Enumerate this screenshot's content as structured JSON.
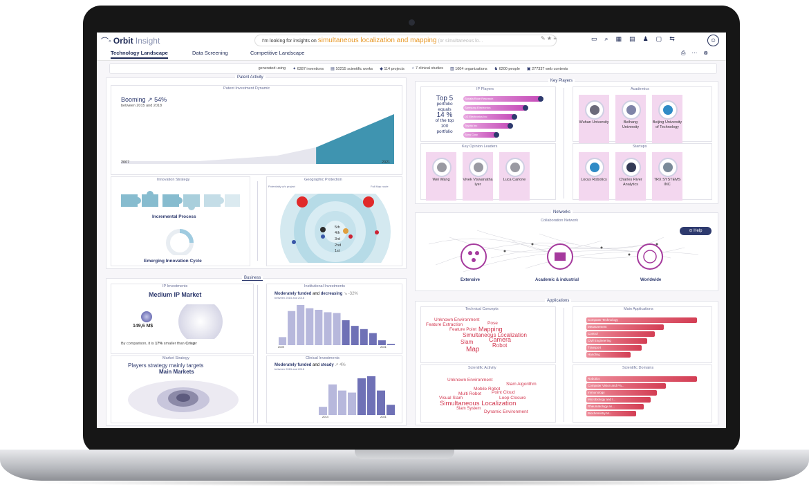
{
  "topbar": {
    "logo_bold": "Orbit",
    "logo_light": "Insight",
    "search_prefix": "I'm looking for insights on",
    "search_keyword": "simultaneous localization and mapping",
    "search_ghost": "(or simultaneous lo...",
    "icons": [
      "edit-icon",
      "star-icon",
      "filter-icon",
      "folder-icon",
      "search-icon",
      "grid-icon",
      "calendar-icon",
      "user-icon",
      "chat-icon",
      "share-icon",
      "avatar-icon"
    ]
  },
  "tabs": {
    "items": [
      "Technology Landscape",
      "Data Screening",
      "Competitive Landscape"
    ],
    "active": "Technology Landscape"
  },
  "stats": {
    "prefix": "generated using",
    "items": [
      "6287 inventions",
      "10215 scientific works",
      "114 projects",
      "7 clinical studies",
      "1604 organizations",
      "6200 people",
      "277337 web contents"
    ]
  },
  "patent_activity": {
    "section": "Patent Activity",
    "sub": "Patent Investment Dynamic",
    "headline": "Booming ↗ 54%",
    "period": "between 2015 and 2018",
    "x_start": "2007",
    "x_end": "2021",
    "chart_data": {
      "type": "area",
      "x": [
        2007,
        2009,
        2011,
        2013,
        2015,
        2017,
        2019,
        2021
      ],
      "values": [
        1,
        1,
        1,
        2,
        3,
        6,
        12,
        18
      ]
    }
  },
  "innovation": {
    "title": "Innovation Strategy",
    "label1": "Incremental Process",
    "label2": "Emerging Innovation Cycle"
  },
  "geo": {
    "title": "Geographic Protection",
    "left_label": "Potentially w/o project",
    "right_label": "Full Map route",
    "ranks": [
      "5th",
      "4th",
      "3rd",
      "2nd",
      "1st"
    ]
  },
  "business": {
    "section": "Business",
    "ip": {
      "title": "IP Investments",
      "heading": "Medium IP Market",
      "value": "149,6 M$",
      "compare_pre": "By comparison, it is",
      "compare_pct": "17%",
      "compare_mid": "smaller than",
      "compare_ref": "Crispr"
    },
    "institutional": {
      "title": "Institutional Investments",
      "headline_a": "Moderately funded",
      "headline_b": "and",
      "headline_c": "decreasing",
      "headline_d": "↘ -32%",
      "period": "between 2015 and 2018",
      "x_start": "2009",
      "x_end": "2021",
      "chart_data": {
        "type": "bar",
        "categories": [
          "2009",
          "2010",
          "2011",
          "2012",
          "2013",
          "2014",
          "2015",
          "2016",
          "2017",
          "2018",
          "2019",
          "2020",
          "2021"
        ],
        "values": [
          20,
          85,
          100,
          92,
          88,
          82,
          80,
          62,
          48,
          40,
          30,
          12,
          3
        ]
      }
    },
    "market": {
      "title": "Market Strategy",
      "line1": "Players strategy mainly targets",
      "line2": "Main Markets"
    },
    "clinical": {
      "title": "Clinical Investments",
      "headline_a": "Moderately funded",
      "headline_b": "and",
      "headline_c": "steady",
      "headline_d": "↗ 4%",
      "period": "between 2015 and 2018",
      "x_start": "2014",
      "x_end": "2021",
      "chart_data": {
        "type": "bar",
        "categories": [
          "2014",
          "2015",
          "2016",
          "2017",
          "2018",
          "2019",
          "2020",
          "2021"
        ],
        "values": [
          20,
          75,
          60,
          55,
          90,
          95,
          60,
          25
        ]
      }
    }
  },
  "key_players": {
    "section": "Key Players",
    "ip_players": {
      "title": "IP Players",
      "top_text": [
        "Top 5",
        "portfolio",
        "equals",
        "14 %",
        "of the top",
        "100",
        "portfolio"
      ],
      "bars": [
        {
          "label": "Sonata Rose Research",
          "value": 100
        },
        {
          "label": "Samsung Electronics",
          "value": 78
        },
        {
          "label": "LG Electronics Inc",
          "value": 62
        },
        {
          "label": "Toyota Inc",
          "value": 56
        },
        {
          "label": "Sony Corp",
          "value": 36
        }
      ]
    },
    "academics": {
      "title": "Academics",
      "items": [
        "Wuhan University",
        "Beihang University",
        "Beijing University of Technology"
      ]
    },
    "kol": {
      "title": "Key Opinion Leaders",
      "items": [
        "Wei Wang",
        "Vivek Viswanatha Iyer",
        "Luca Carlone"
      ]
    },
    "startups": {
      "title": "Startups",
      "items": [
        "Locus Robotics",
        "Charles River Analytics",
        "TRX SYSTEMS INC"
      ]
    }
  },
  "networks": {
    "section": "Networks",
    "sub": "Collaboration Network",
    "help": "Help",
    "labels": [
      "Extensive",
      "Academic & industrial",
      "Worldwide"
    ]
  },
  "applications": {
    "section": "Applications",
    "tech_concepts": {
      "title": "Technical Concepts",
      "words": [
        "Unknown Environment",
        "Feature Extraction",
        "Pose",
        "Feature Point",
        "Mapping",
        "Simultaneous Localization",
        "Slam",
        "Camera",
        "Robot",
        "Map"
      ]
    },
    "main_apps": {
      "title": "Main Applications",
      "bars": [
        {
          "label": "Computer Technology",
          "value": 100
        },
        {
          "label": "Measurement",
          "value": 70
        },
        {
          "label": "Control",
          "value": 62
        },
        {
          "label": "Civil Engineering",
          "value": 55
        },
        {
          "label": "Transport",
          "value": 50
        },
        {
          "label": "Handling",
          "value": 40
        }
      ]
    },
    "sci_activity": {
      "title": "Scientific Activity",
      "words": [
        "Unknown Environment",
        "Slam Algorithm",
        "Mobile Robot",
        "Multi Robot",
        "Point Cloud",
        "Visual Slam",
        "Loop Closure",
        "Simultaneous Localization",
        "Slam System",
        "Dynamic Environment"
      ]
    },
    "sci_domains": {
      "title": "Scientific Domains",
      "bars": [
        {
          "label": "Robotics",
          "value": 100
        },
        {
          "label": "Computer Vision and Pa...",
          "value": 72
        },
        {
          "label": "Immunology",
          "value": 64
        },
        {
          "label": "Microbiology and I...",
          "value": 58
        },
        {
          "label": "Rheumatology an...",
          "value": 52
        },
        {
          "label": "Biochemistry M...",
          "value": 45
        }
      ]
    }
  },
  "colors": {
    "navy": "#1e2a55",
    "accent_orange": "#e89b2c",
    "pink": "#c54bb8",
    "red": "#d33e54",
    "teal": "#2e90a8",
    "purple": "#6f71b6"
  }
}
